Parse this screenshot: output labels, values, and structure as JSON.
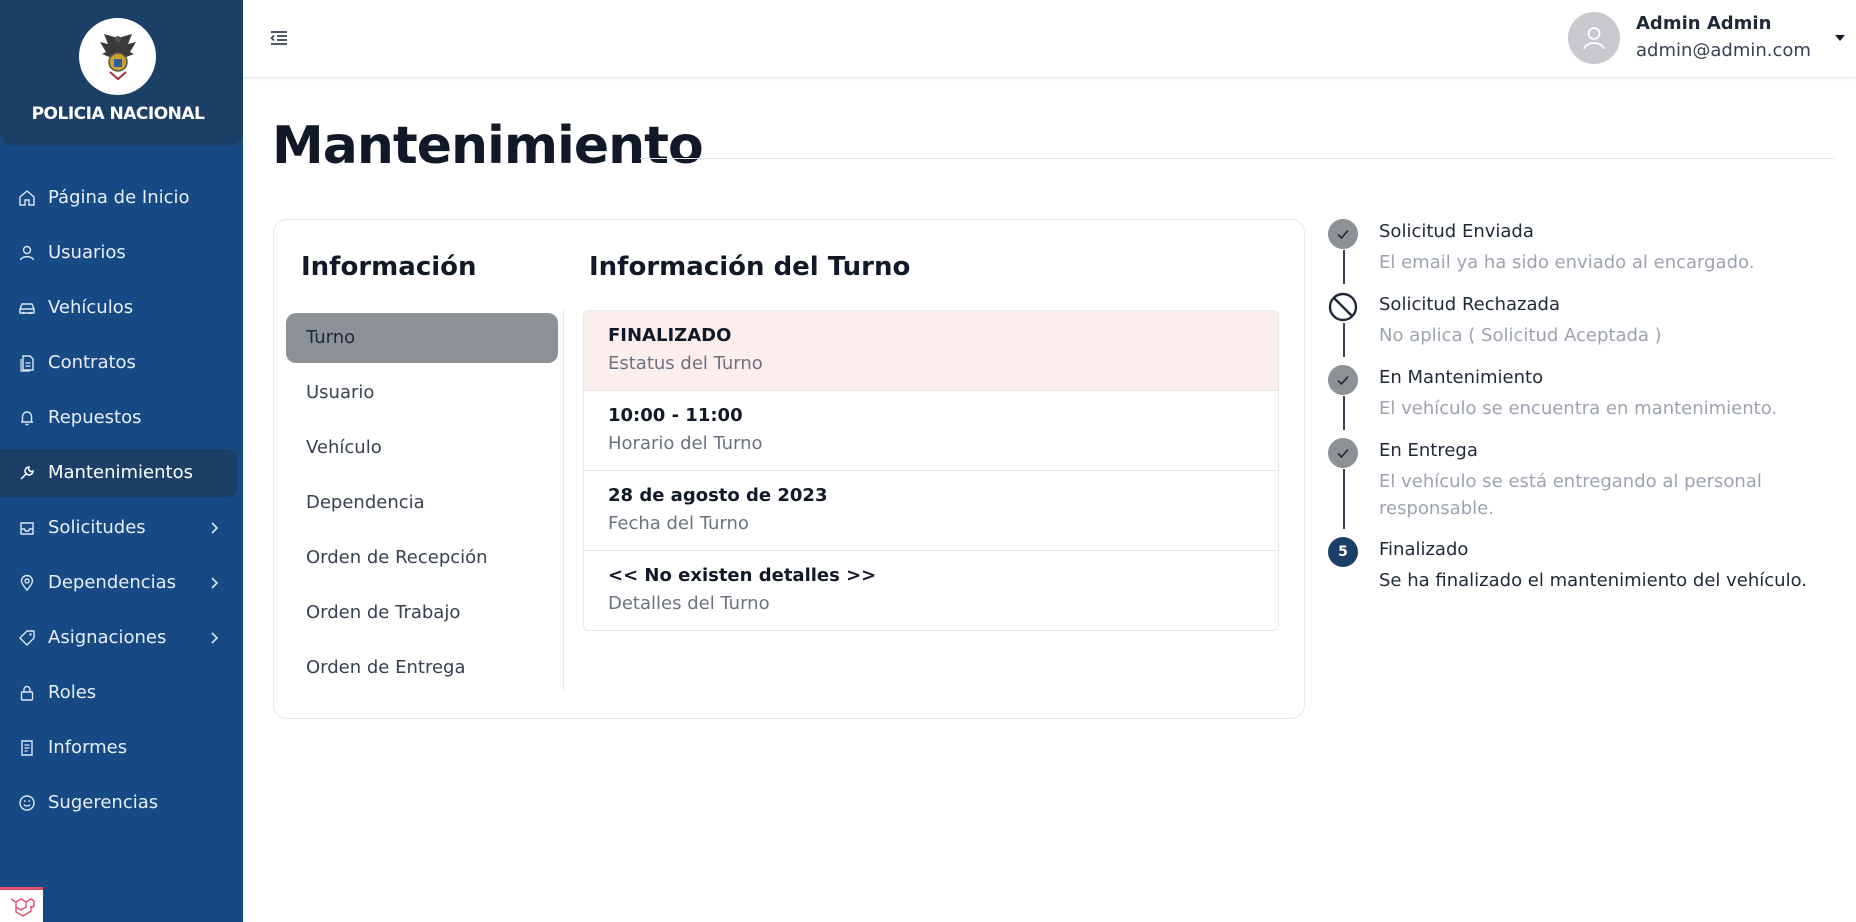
{
  "brand": {
    "name": "POLICIA NACIONAL"
  },
  "sidebar": {
    "items": [
      {
        "label": "Página de Inicio",
        "icon": "home-icon"
      },
      {
        "label": "Usuarios",
        "icon": "user-icon"
      },
      {
        "label": "Vehículos",
        "icon": "car-icon"
      },
      {
        "label": "Contratos",
        "icon": "document-icon"
      },
      {
        "label": "Repuestos",
        "icon": "bell-icon"
      },
      {
        "label": "Mantenimientos",
        "icon": "wrench-icon",
        "active": true
      },
      {
        "label": "Solicitudes",
        "icon": "inbox-icon",
        "expandable": true
      },
      {
        "label": "Dependencias",
        "icon": "location-icon",
        "expandable": true
      },
      {
        "label": "Asignaciones",
        "icon": "tag-icon",
        "expandable": true
      },
      {
        "label": "Roles",
        "icon": "lock-icon"
      },
      {
        "label": "Informes",
        "icon": "report-icon"
      },
      {
        "label": "Sugerencias",
        "icon": "smile-icon"
      }
    ]
  },
  "header": {
    "user_name": "Admin Admin",
    "user_email": "admin@admin.com"
  },
  "page": {
    "title": "Mantenimiento"
  },
  "info_panel": {
    "title": "Información",
    "items": [
      {
        "label": "Turno",
        "active": true
      },
      {
        "label": "Usuario"
      },
      {
        "label": "Vehículo"
      },
      {
        "label": "Dependencia"
      },
      {
        "label": "Orden de Recepción"
      },
      {
        "label": "Orden de Trabajo"
      },
      {
        "label": "Orden de Entrega"
      }
    ]
  },
  "turno": {
    "title": "Información del Turno",
    "rows": [
      {
        "value": "FINALIZADO",
        "label": "Estatus del Turno",
        "highlight": true
      },
      {
        "value": "10:00 - 11:00",
        "label": "Horario del Turno"
      },
      {
        "value": "28 de agosto de 2023",
        "label": "Fecha del Turno"
      },
      {
        "value": "<< No existen detalles >>",
        "label": "Detalles del Turno"
      }
    ]
  },
  "timeline": {
    "steps": [
      {
        "title": "Solicitud Enviada",
        "desc": "El email ya ha sido enviado al encargado.",
        "state": "done"
      },
      {
        "title": "Solicitud Rechazada",
        "desc": "No aplica ( Solicitud Aceptada )",
        "state": "skipped"
      },
      {
        "title": "En Mantenimiento",
        "desc": "El vehículo se encuentra en mantenimiento.",
        "state": "done"
      },
      {
        "title": "En Entrega",
        "desc": "El vehículo se está entregando al personal responsable.",
        "state": "done"
      },
      {
        "title": "Finalizado",
        "desc": "Se ha finalizado el mantenimiento del vehículo.",
        "state": "current",
        "number": "5"
      }
    ]
  },
  "colors": {
    "sidebar_bg": "#174a85",
    "sidebar_active": "#1c3f68",
    "active_tab": "#8c9196",
    "highlight_row": "#fdeeee"
  }
}
